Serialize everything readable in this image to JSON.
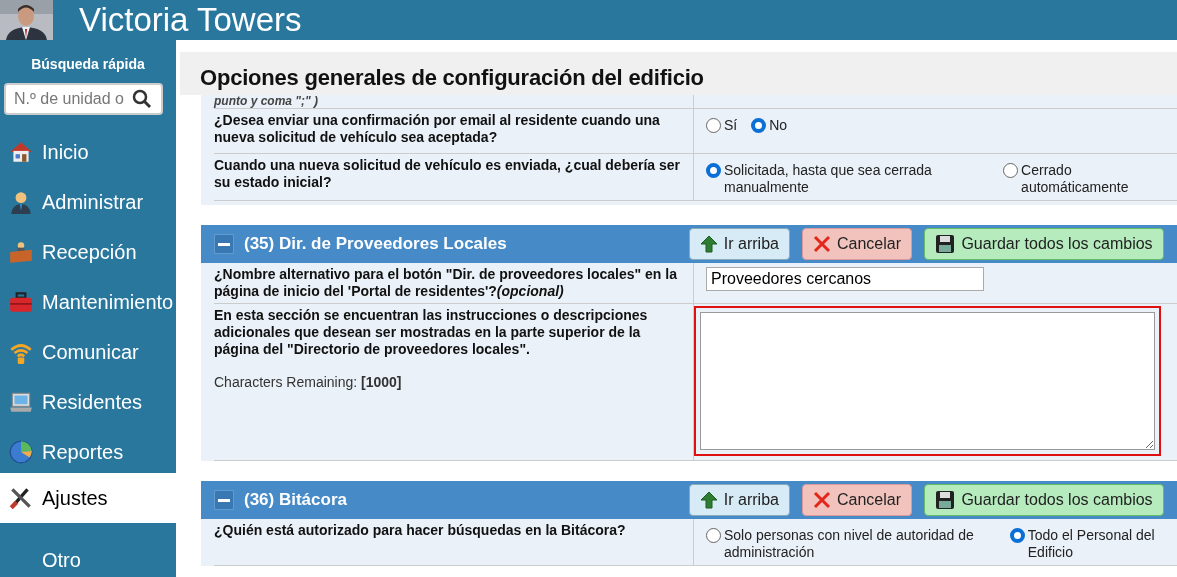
{
  "header": {
    "title": "Victoria Towers"
  },
  "sidebar": {
    "search_title": "Búsqueda rápida",
    "search": {
      "placeholder": "N.º de unidad o"
    },
    "items": [
      {
        "label": "Inicio",
        "selected": false
      },
      {
        "label": "Administrar",
        "selected": false
      },
      {
        "label": "Recepción",
        "selected": false
      },
      {
        "label": "Mantenimiento",
        "selected": false
      },
      {
        "label": "Comunicar",
        "selected": false
      },
      {
        "label": "Residentes",
        "selected": false
      },
      {
        "label": "Reportes",
        "selected": false
      },
      {
        "label": "Ajustes",
        "selected": true
      },
      {
        "label": "Otro",
        "selected": false
      }
    ]
  },
  "page_title": "Opciones generales de configuración del edificio",
  "previous_rows": [
    {
      "kind": "note",
      "question": "punto y coma \";\" )"
    },
    {
      "kind": "radio",
      "question": "¿Desea enviar una confirmación por email al residente cuando una nueva solicitud de vehículo sea aceptada?",
      "options": [
        {
          "label": "Sí",
          "selected": false
        },
        {
          "label": "No",
          "selected": true
        }
      ]
    },
    {
      "kind": "radio",
      "question": "Cuando una nueva solicitud de vehículo es enviada, ¿cual debería ser su estado inicial?",
      "options": [
        {
          "label": "Solicitada, hasta que sea cerrada manualmente",
          "selected": true
        },
        {
          "label": "Cerrado automáticamente",
          "selected": false
        }
      ]
    }
  ],
  "sections": [
    {
      "title": "(35) Dir. de Proveedores Locales",
      "buttons": [
        "Ir arriba",
        "Cancelar",
        "Guardar todos los cambios"
      ],
      "rows": [
        {
          "kind": "text",
          "question": "¿Nombre alternativo para el botón \"Dir. de proveedores locales\" en la página de inicio del 'Portal de residentes'?*(opcional)*",
          "value": "Proveedores cercanos"
        },
        {
          "kind": "textarea",
          "question": "En esta sección se encuentran las instrucciones o descripciones adicionales que desean ser mostradas en la parte superior de la página del \"Directorio de proveedores locales\".",
          "counter": "Characters Remaining: **[1000]**",
          "highlighted": true
        }
      ]
    },
    {
      "title": "(36) Bitácora",
      "buttons": [
        "Ir arriba",
        "Cancelar",
        "Guardar todos los cambios"
      ],
      "rows": [
        {
          "kind": "radio",
          "question": "¿Quién está autorizado para hacer búsquedas en la Bitácora?",
          "options": [
            {
              "label": "Solo personas con nivel de autoridad de administración",
              "selected": false
            },
            {
              "label": "Todo el Personal del Edificio",
              "selected": true
            }
          ]
        }
      ]
    }
  ]
}
